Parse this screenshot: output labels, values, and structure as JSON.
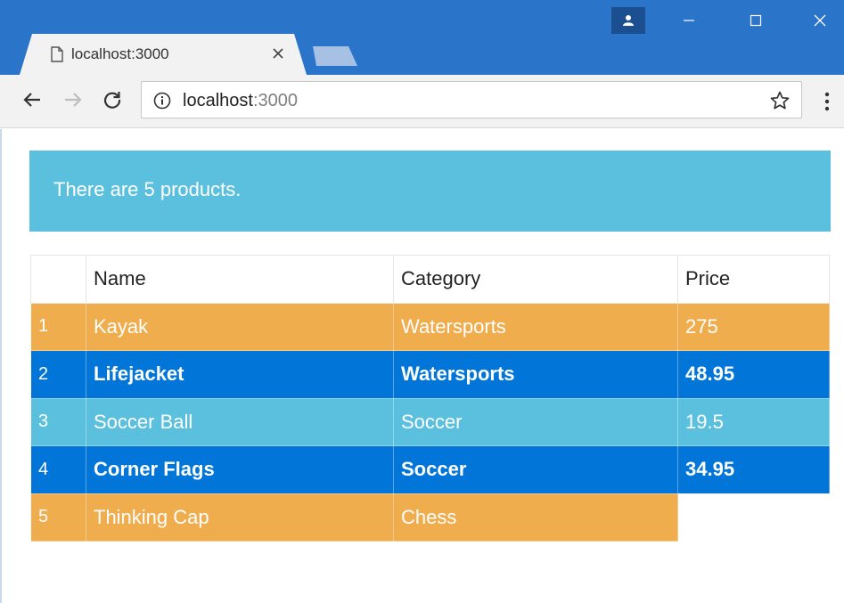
{
  "browser": {
    "tab_title": "localhost:3000",
    "url_host": "localhost",
    "url_port": ":3000",
    "icons": {
      "profile": "person-icon",
      "minimize": "minimize-icon",
      "maximize": "maximize-icon",
      "close": "close-icon",
      "tab_page": "document-icon",
      "tab_close": "close-icon",
      "back": "arrow-left-icon",
      "forward": "arrow-right-icon",
      "reload": "reload-icon",
      "info": "info-icon",
      "bookmark": "star-icon",
      "menu": "kebab-menu-icon"
    },
    "colors": {
      "titlebar": "#2a74c9",
      "tab": "#f2f2f2"
    }
  },
  "alert": {
    "text": "There are 5 products.",
    "color": "#5bc0de"
  },
  "table": {
    "headers": [
      "",
      "Name",
      "Category",
      "Price"
    ],
    "rows": [
      {
        "index": "1",
        "name": "Kayak",
        "category": "Watersports",
        "price": "275",
        "style": "warning"
      },
      {
        "index": "2",
        "name": "Lifejacket",
        "category": "Watersports",
        "price": "48.95",
        "style": "primary"
      },
      {
        "index": "3",
        "name": "Soccer Ball",
        "category": "Soccer",
        "price": "19.5",
        "style": "info"
      },
      {
        "index": "4",
        "name": "Corner Flags",
        "category": "Soccer",
        "price": "34.95",
        "style": "primary"
      },
      {
        "index": "5",
        "name": "Thinking Cap",
        "category": "Chess",
        "price": "",
        "style": "warning"
      }
    ],
    "colors": {
      "warning": "#f0ad4e",
      "primary": "#0275d8",
      "info": "#5bc0de"
    }
  }
}
